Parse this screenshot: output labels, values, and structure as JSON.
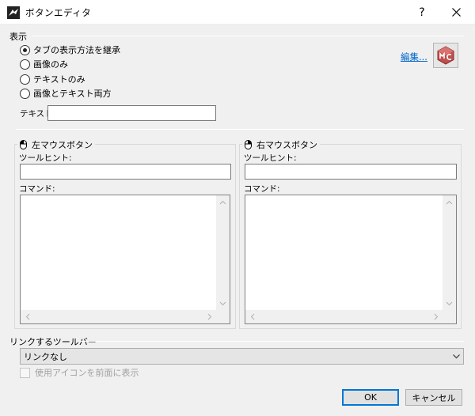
{
  "window": {
    "title": "ボタンエディタ",
    "help": "?",
    "close": "✕"
  },
  "display_group": {
    "label": "表示",
    "options": [
      {
        "label": "タブの表示方法を継承",
        "checked": true
      },
      {
        "label": "画像のみ",
        "checked": false
      },
      {
        "label": "テキストのみ",
        "checked": false
      },
      {
        "label": "画像とテキスト両方",
        "checked": false
      }
    ],
    "text_label": "テキスト:",
    "text_value": "",
    "edit_link": "編集..."
  },
  "left_mouse": {
    "title": "左マウスボタン",
    "tooltip_label": "ツールヒント:",
    "tooltip_value": "",
    "command_label": "コマンド:",
    "command_value": ""
  },
  "right_mouse": {
    "title": "右マウスボタン",
    "tooltip_label": "ツールヒント:",
    "tooltip_value": "",
    "command_label": "コマンド:",
    "command_value": ""
  },
  "linked_toolbar": {
    "label": "リンクするツールバー",
    "selected": "リンクなし",
    "checkbox_label": "使用アイコンを前面に表示",
    "checkbox_checked": false
  },
  "footer": {
    "ok": "OK",
    "cancel": "キャンセル"
  },
  "colors": {
    "link": "#0066cc",
    "primary_border": "#0078d7",
    "macro_icon": "#c0504d"
  }
}
